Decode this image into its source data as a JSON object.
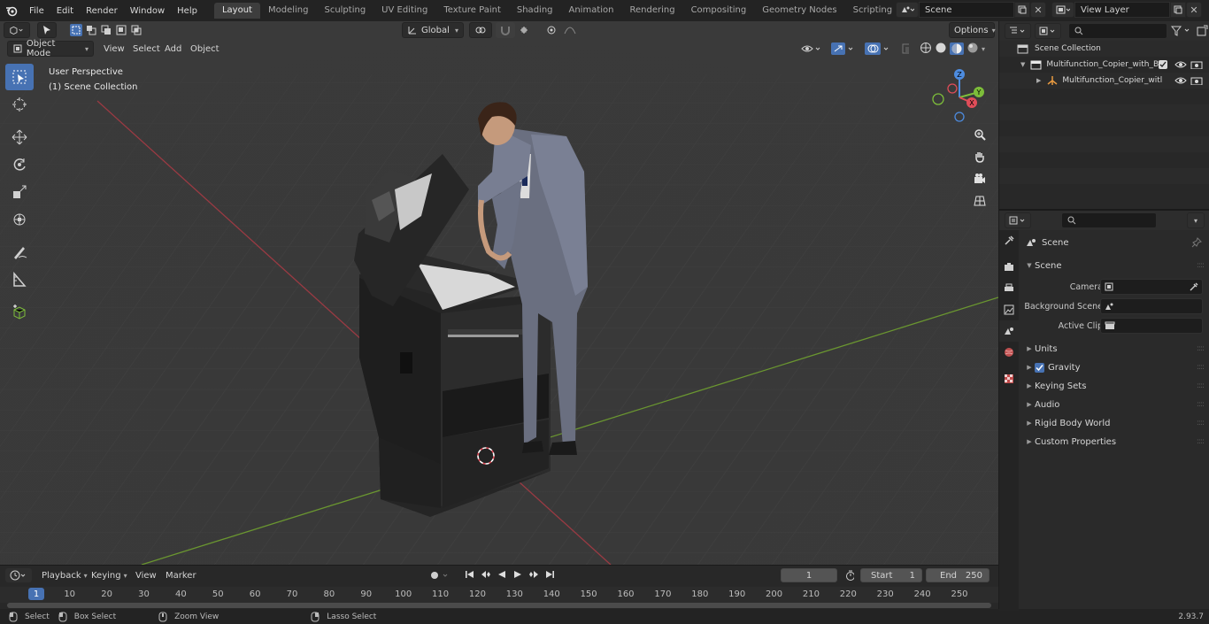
{
  "menu": [
    "File",
    "Edit",
    "Render",
    "Window",
    "Help"
  ],
  "workspaces": [
    "Layout",
    "Modeling",
    "Sculpting",
    "UV Editing",
    "Texture Paint",
    "Shading",
    "Animation",
    "Rendering",
    "Compositing",
    "Geometry Nodes",
    "Scripting"
  ],
  "active_workspace": "Layout",
  "scene_name": "Scene",
  "view_layer_name": "View Layer",
  "viewport": {
    "mode": "Object Mode",
    "menus": [
      "View",
      "Select",
      "Add",
      "Object"
    ],
    "transform_orientation": "Global",
    "options_label": "Options",
    "overlay_title": "User Perspective",
    "overlay_subtitle": "(1) Scene Collection",
    "gizmo": {
      "x": "X",
      "y": "Y",
      "z": "Z"
    }
  },
  "timeline": {
    "menus": [
      "Playback",
      "Keying",
      "View",
      "Marker"
    ],
    "current_frame": "1",
    "start_label": "Start",
    "start_value": "1",
    "end_label": "End",
    "end_value": "250",
    "ticks": [
      "1",
      "10",
      "20",
      "30",
      "40",
      "50",
      "60",
      "70",
      "80",
      "90",
      "100",
      "110",
      "120",
      "130",
      "140",
      "150",
      "160",
      "170",
      "180",
      "190",
      "200",
      "210",
      "220",
      "230",
      "240",
      "250"
    ]
  },
  "statusbar": {
    "select": "Select",
    "box_select": "Box Select",
    "zoom_view": "Zoom View",
    "lasso_select": "Lasso Select",
    "version": "2.93.7"
  },
  "outliner": {
    "root": "Scene Collection",
    "collection": "Multifunction_Copier_with_Bu",
    "object": "Multifunction_Copier_witl"
  },
  "properties": {
    "context_title": "Scene",
    "section_scene": "Scene",
    "camera_label": "Camera",
    "background_scene_label": "Background Scene",
    "active_clip_label": "Active Clip",
    "panels": [
      "Units",
      "Gravity",
      "Keying Sets",
      "Audio",
      "Rigid Body World",
      "Custom Properties"
    ],
    "gravity_enabled": true
  },
  "colors": {
    "accent": "#4772b3",
    "x_axis": "#e04d59",
    "y_axis": "#7dbd3a",
    "z_axis": "#4d8ce0",
    "grid_x_line": "#9a3a43",
    "grid_y_line": "#6a9630"
  }
}
